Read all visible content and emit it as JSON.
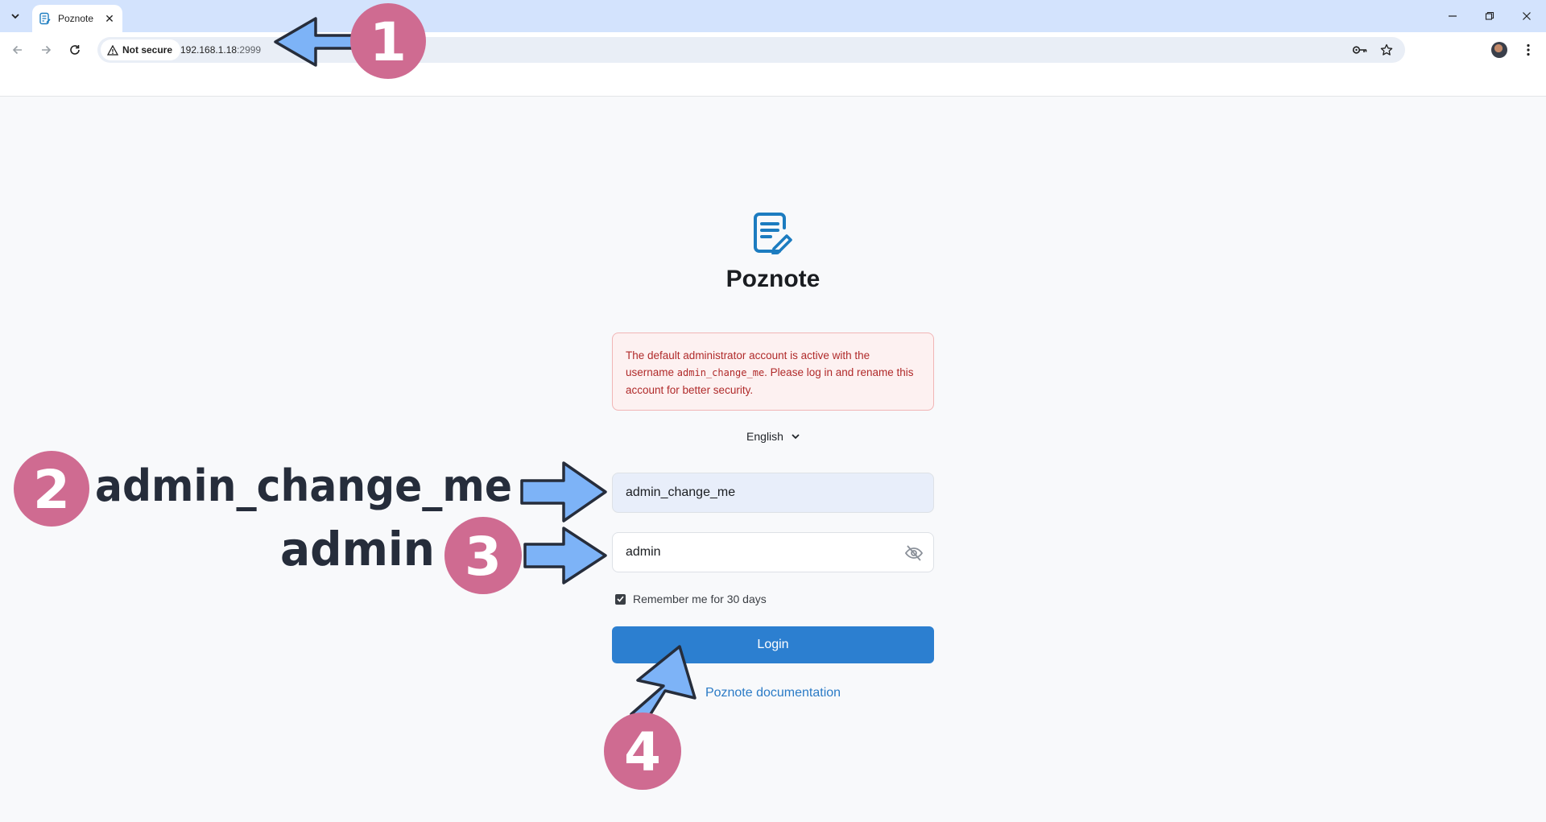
{
  "browser": {
    "tab_title": "Poznote",
    "tab_close": "✕",
    "security_label": "Not secure",
    "url_host": "192.168.1.18",
    "url_port": ":2999",
    "icons": [
      "tab-search-icon",
      "poznote-favicon",
      "back-icon",
      "forward-icon",
      "reload-icon",
      "warning-icon",
      "key-icon",
      "star-icon",
      "minimize-icon",
      "restore-icon",
      "close-icon",
      "kebab-menu-icon"
    ]
  },
  "page": {
    "app_name": "Poznote",
    "alert": {
      "part1": "The default administrator account is active with the username ",
      "code": "admin_change_me",
      "part2": ". Please log in and rename this account for better security."
    },
    "language": {
      "selected": "English"
    },
    "username_value": "admin_change_me",
    "password_value": "admin",
    "remember_label": "Remember me for 30 days",
    "remember_checked": true,
    "login_label": "Login",
    "doc_link": "Poznote documentation"
  },
  "annotations": {
    "badges": [
      "1",
      "2",
      "3",
      "4"
    ],
    "username_hint": "admin_change_me",
    "password_hint": "admin",
    "badge_color": "#cf6b91",
    "arrow_color": "#7db3f7",
    "text_color": "#262d3b"
  },
  "colors": {
    "accent": "#2c7fd0",
    "link": "#2b7bc6",
    "alert_text": "#b02a2a",
    "alert_bg": "#fdf1f1",
    "chrome_tabstrip": "#d3e3fd"
  }
}
